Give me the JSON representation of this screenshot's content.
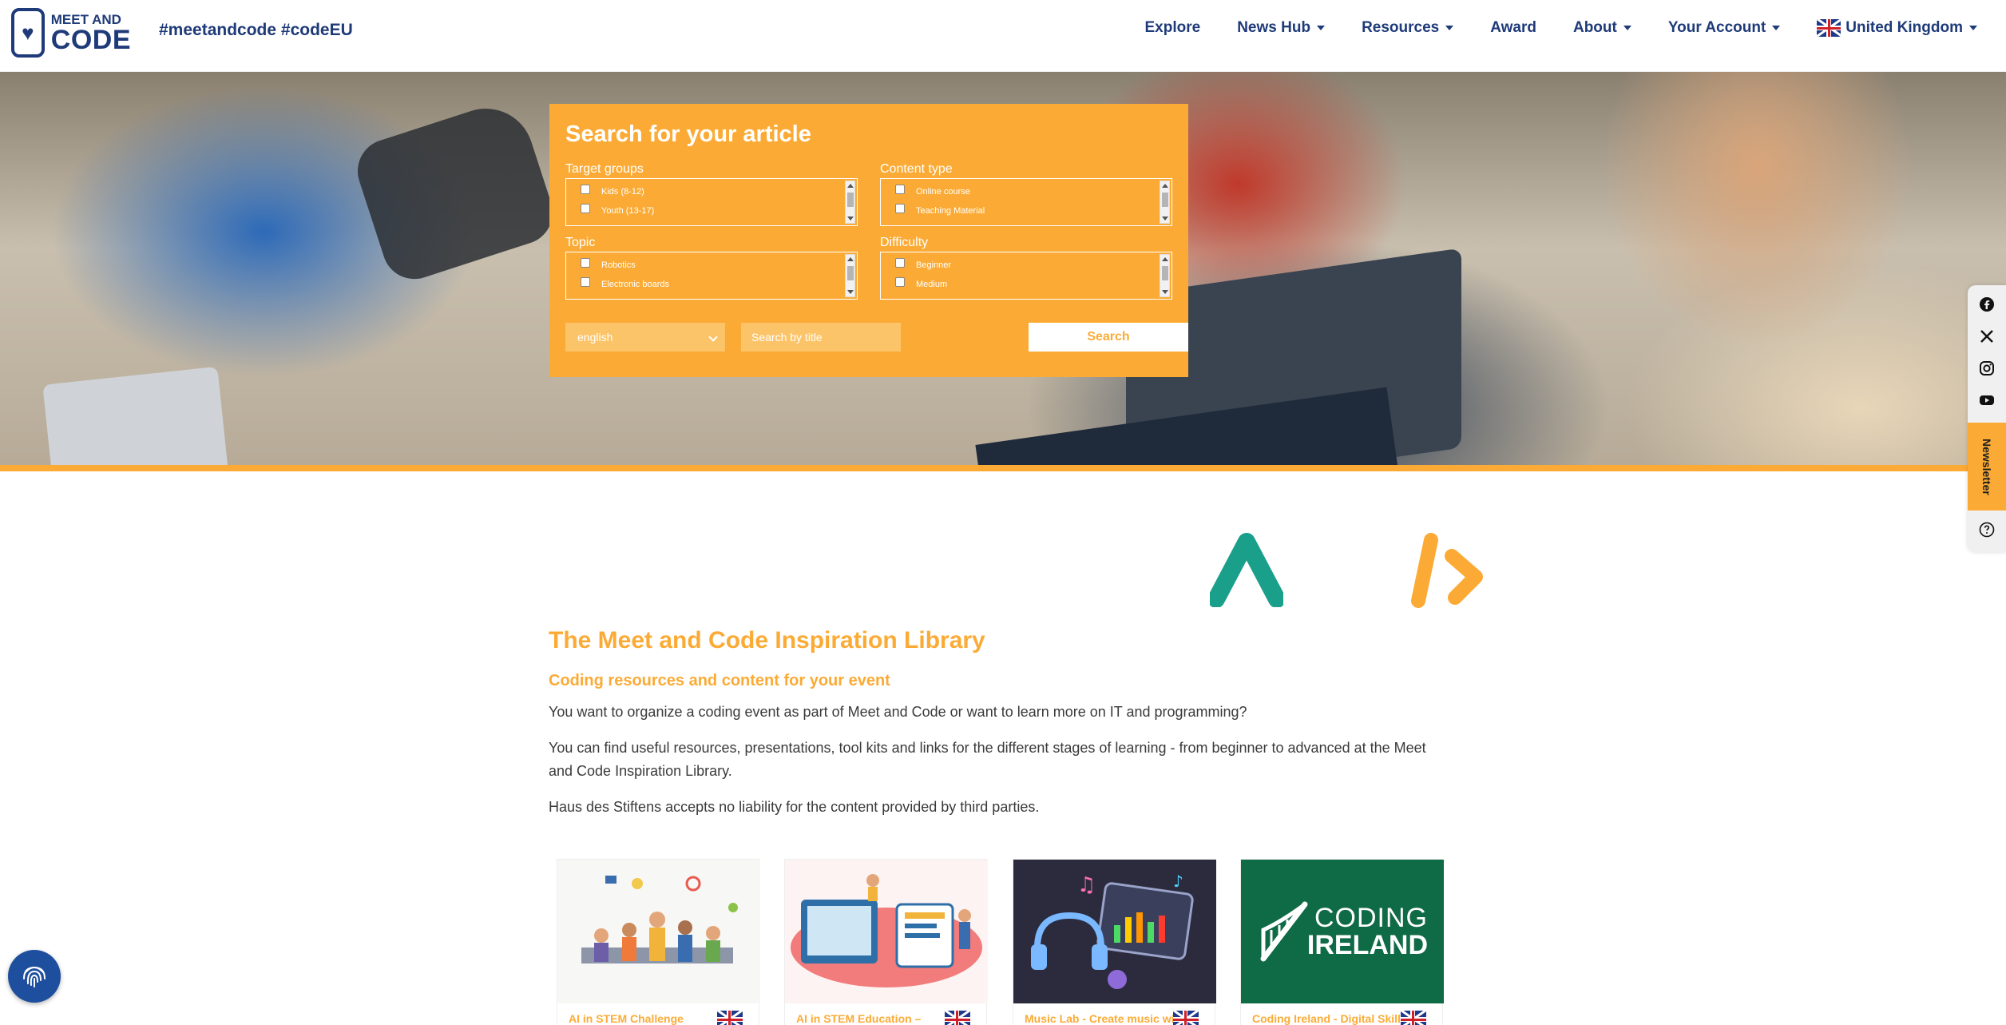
{
  "header": {
    "logo": {
      "line1": "MEET AND",
      "line2": "CODE"
    },
    "hashtags": "#meetandcode #codeEU",
    "nav": [
      {
        "label": "Explore",
        "dropdown": false
      },
      {
        "label": "News Hub",
        "dropdown": true
      },
      {
        "label": "Resources",
        "dropdown": true
      },
      {
        "label": "Award",
        "dropdown": false
      },
      {
        "label": "About",
        "dropdown": true
      },
      {
        "label": "Your Account",
        "dropdown": true
      }
    ],
    "country": {
      "label": "United Kingdom",
      "icon": "uk-flag-icon"
    }
  },
  "search": {
    "title": "Search for your article",
    "filters": {
      "target_groups": {
        "label": "Target groups",
        "options": [
          "Kids (8-12)",
          "Youth (13-17)"
        ]
      },
      "content_type": {
        "label": "Content type",
        "options": [
          "Online course",
          "Teaching Material"
        ]
      },
      "topic": {
        "label": "Topic",
        "options": [
          "Robotics",
          "Electronic boards"
        ]
      },
      "difficulty": {
        "label": "Difficulty",
        "options": [
          "Beginner",
          "Medium"
        ]
      }
    },
    "language": {
      "selected": "english"
    },
    "title_input": {
      "placeholder": "Search by title"
    },
    "button_label": "Search"
  },
  "social": {
    "icons": [
      "facebook-icon",
      "x-icon",
      "instagram-icon",
      "youtube-icon"
    ],
    "newsletter_label": "Newsletter",
    "help_icon": "help-icon"
  },
  "library": {
    "title": "The Meet and Code Inspiration Library",
    "subtitle": "Coding resources and content for your event",
    "paragraphs": [
      "You want to organize a coding event as part of Meet and Code or want to learn more on IT and programming?",
      "You can find useful resources, presentations, tool kits and links for the different stages of learning - from beginner to advanced at the Meet and Code Inspiration Library.",
      "Haus des Stiftens accepts no liability for the content provided by third parties."
    ]
  },
  "cards": [
    {
      "title": "AI in STEM Challenge",
      "flag": "uk-flag-icon"
    },
    {
      "title": "AI in STEM Education –",
      "flag": "uk-flag-icon"
    },
    {
      "title": "Music Lab - Create music with",
      "flag": "uk-flag-icon"
    },
    {
      "title": "Coding Ireland - Digital Skills",
      "flag": "uk-flag-icon",
      "image_text": [
        "CODING",
        "IRELAND"
      ]
    }
  ],
  "colors": {
    "brand_navy": "#1e3a78",
    "accent_orange": "#fbab35",
    "accent_teal": "#1a9f8a"
  }
}
